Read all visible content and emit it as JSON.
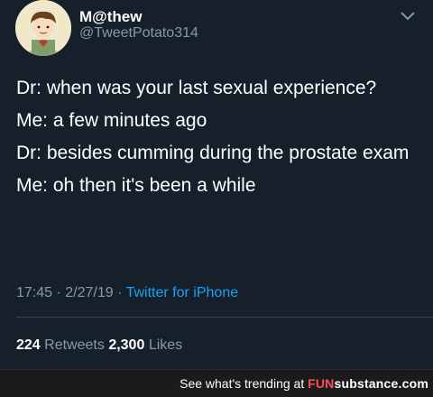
{
  "tweet": {
    "display_name": "M@thew",
    "handle": "@TweetPotato314",
    "lines": [
      "Dr: when was your last sexual experience?",
      "Me: a few minutes ago",
      "Dr: besides cumming during the prostate exam",
      "Me: oh then it's been a while"
    ],
    "time": "17:45",
    "date": "2/27/19",
    "separator": "·",
    "source": "Twitter for iPhone",
    "retweets_count": "224",
    "retweets_label": "Retweets",
    "likes_count": "2,300",
    "likes_label": "Likes"
  },
  "footer": {
    "text": "See what's trending at",
    "brand_fun": "FUN",
    "brand_rest": "substance.com"
  },
  "icons": {
    "avatar": "avatar-cartoon-boy",
    "menu": "chevron-down-icon"
  },
  "colors": {
    "background": "#15202b",
    "secondary_text": "#8899a6",
    "link": "#1da1f2",
    "brand_accent": "#ff4b5c"
  }
}
